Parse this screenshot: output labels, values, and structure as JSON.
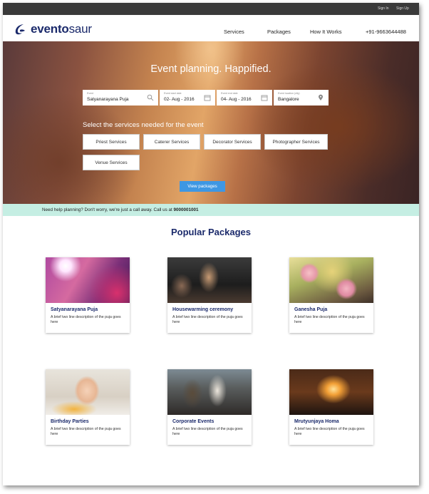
{
  "topbar": {
    "sign_in": "Sign In",
    "sign_up": "Sign Up"
  },
  "header": {
    "brand_prefix": "evento",
    "brand_suffix": "saur",
    "nav": [
      "Services",
      "Packages",
      "How It Works",
      "+91-9663644488"
    ]
  },
  "hero": {
    "title": "Event planning. Happified.",
    "search": [
      {
        "label": "Event",
        "value": "Satyanarayana Puja",
        "icon": "search-icon"
      },
      {
        "label": "Event start date",
        "value": "02- Aug - 2016",
        "icon": "calendar-icon"
      },
      {
        "label": "Event end date",
        "value": "04- Aug - 2016",
        "icon": "calendar-icon"
      },
      {
        "label": "Event location (city)",
        "value": "Bangalore",
        "icon": "location-pin-icon"
      }
    ],
    "services_title": "Select the services needed for the event",
    "services": [
      "Priest Services",
      "Caterer Services",
      "Decorator Services",
      "Photographer Services",
      "Venue Services"
    ],
    "view_button": "View packages"
  },
  "help": {
    "text": "Need help planning? Don't worry, we're just a call away. Call us at",
    "phone": "9000001001"
  },
  "popular": {
    "title": "Popular Packages",
    "cards": [
      {
        "name": "Satyanarayana Puja",
        "desc": "A brief two line description of the puja goes here"
      },
      {
        "name": "Housewarming ceremony",
        "desc": "A brief two line description of the puja goes here"
      },
      {
        "name": "Ganesha Puja",
        "desc": "A brief two line description of the puja goes here"
      },
      {
        "name": "Birthday Parties",
        "desc": "A brief two line description of the puja goes here"
      },
      {
        "name": "Corporate Events",
        "desc": "A brief two line description of the puja goes here"
      },
      {
        "name": "Mrutyunjaya Homa",
        "desc": "A brief two line description of the puja goes here"
      }
    ]
  },
  "colors": {
    "brand": "#1b2a6b",
    "accent": "#3e97e3",
    "help_bar": "#c5eee3",
    "top_bar": "#3a3a3a"
  }
}
